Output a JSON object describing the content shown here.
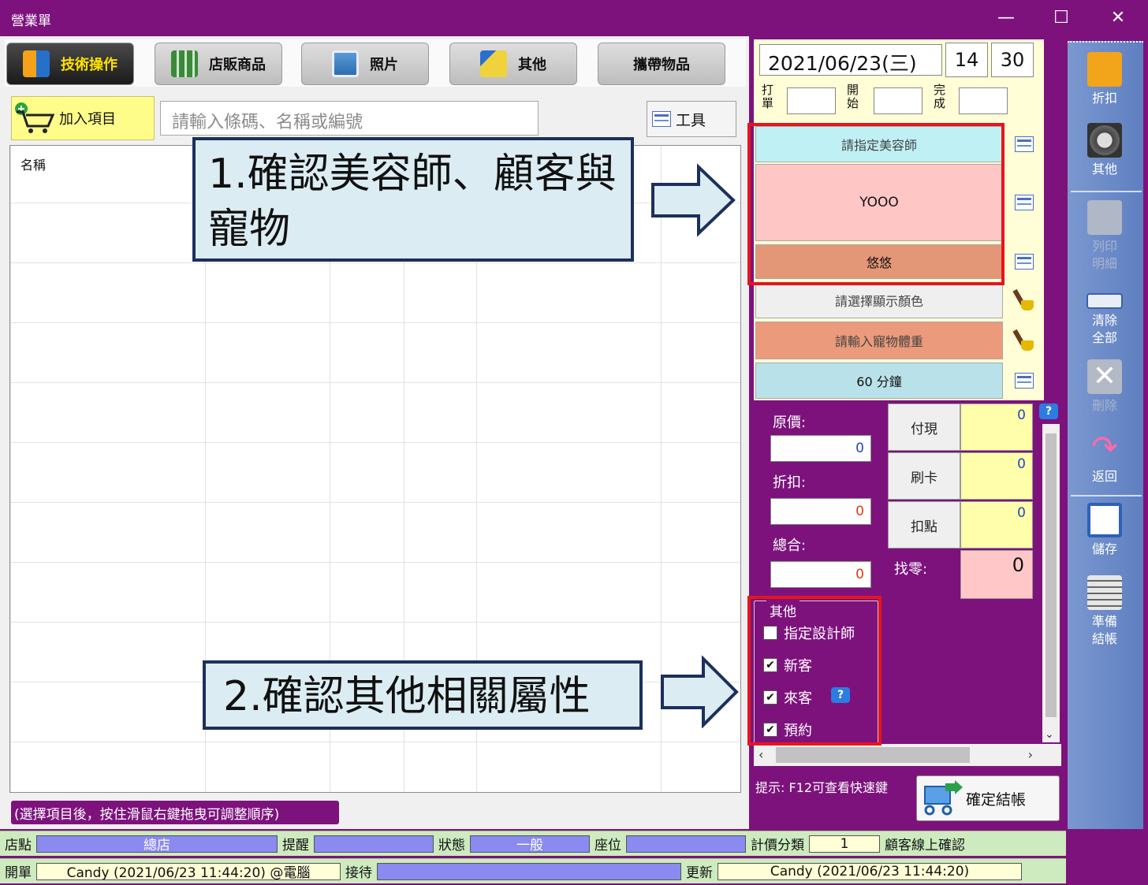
{
  "window": {
    "title": "營業單",
    "minimize": "—",
    "maximize": "☐",
    "close": "✕"
  },
  "tabs": [
    {
      "label": "技術操作",
      "active": true
    },
    {
      "label": "店販商品"
    },
    {
      "label": "照片"
    },
    {
      "label": "其他"
    },
    {
      "label": "攜帶物品"
    }
  ],
  "toolbar_row": {
    "add_label": "加入項目",
    "search_placeholder": "請輸入條碼、名稱或編號",
    "tool_label": "工具"
  },
  "list": {
    "column_name": "名稱",
    "hint": "(選擇項目後，按住滑鼠右鍵拖曳可調整順序)"
  },
  "datetime": {
    "date": "2021/06/23(三)",
    "hour": "14",
    "minute": "30",
    "label_punch": "打單",
    "label_start": "開始",
    "label_finish": "完成"
  },
  "assign": {
    "beautician": "請指定美容師",
    "customer": "YOOO",
    "pet": "悠悠",
    "color": "請選擇顯示顏色",
    "weight": "請輸入寵物體重",
    "duration": "60 分鐘"
  },
  "amounts": {
    "original_label": "原價:",
    "original_value": "0",
    "discount_label": "折扣:",
    "discount_value": "0",
    "total_label": "總合:",
    "total_value": "0"
  },
  "payment": {
    "cash_label": "付現",
    "cash_value": "0",
    "card_label": "刷卡",
    "card_value": "0",
    "points_label": "扣點",
    "points_value": "0",
    "change_label": "找零:",
    "change_value": "0"
  },
  "other_group": {
    "title": "其他",
    "items": [
      {
        "label": "指定設計師",
        "checked": false
      },
      {
        "label": "新客",
        "checked": true
      },
      {
        "label": "來客",
        "checked": true
      },
      {
        "label": "預約",
        "checked": true
      }
    ],
    "check_mark": "✔",
    "help": "?"
  },
  "tip": "提示: F12可查看快速鍵",
  "confirm_label": "確定結帳",
  "side_toolbar": [
    {
      "label": "折扣",
      "icon": "discount-icon"
    },
    {
      "label": "其他",
      "icon": "gear-icon"
    },
    {
      "label": "列印明細",
      "icon": "printer-icon",
      "disabled": true
    },
    {
      "label": "清除全部",
      "icon": "clear-icon"
    },
    {
      "label": "刪除",
      "icon": "delete-icon",
      "disabled": true
    },
    {
      "label": "返回",
      "icon": "return-icon"
    },
    {
      "label": "儲存",
      "icon": "save-icon"
    },
    {
      "label": "準備結帳",
      "icon": "checklist-icon"
    }
  ],
  "status1": {
    "store_label": "店點",
    "store_value": "總店",
    "remind_label": "提醒",
    "remind_value": "",
    "state_label": "狀態",
    "state_value": "一般",
    "seat_label": "座位",
    "seat_value": "",
    "price_label": "計價分類",
    "price_value": "1",
    "online_label": "顧客線上確認"
  },
  "status2": {
    "open_label": "開單",
    "open_value": "Candy (2021/06/23 11:44:20) @電腦",
    "recv_label": "接待",
    "recv_value": "",
    "update_label": "更新",
    "update_value": "Candy (2021/06/23 11:44:20)"
  },
  "annotations": {
    "step1": "1.確認美容師、顧客與寵物",
    "step2": "2.確認其他相關屬性"
  },
  "colors": {
    "frame": "#7d127d",
    "accent_yellow": "#ffe100",
    "annotation_border": "#e8141c"
  }
}
